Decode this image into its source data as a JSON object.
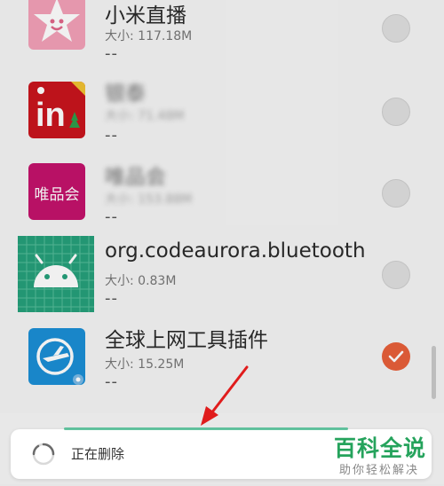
{
  "apps": [
    {
      "name": "小米直播",
      "size": "大小: 117.18M",
      "dash": "--",
      "checked": false
    },
    {
      "name": "银泰",
      "size": "大小: 71.48M",
      "dash": "--",
      "checked": false
    },
    {
      "name": "唯品会",
      "size": "大小: 153.88M",
      "dash": "--",
      "checked": false,
      "icon_text": "唯品会"
    },
    {
      "name": "org.codeaurora.bluetooth",
      "size": "大小: 0.83M",
      "dash": "--",
      "checked": false
    },
    {
      "name": "全球上网工具插件",
      "size": "大小: 15.25M",
      "dash": "--",
      "checked": true
    }
  ],
  "status": {
    "text": "正在删除"
  },
  "watermark": {
    "main": "百科全说",
    "sub": "助你轻松解决"
  },
  "colors": {
    "accent": "#e8603a",
    "brand_green": "#25a35c",
    "vip_pink": "#c4136c",
    "yintai_red": "#c9151d",
    "blue_tool": "#1b8fd6",
    "android_teal": "#26a07b"
  },
  "icons": [
    "star-icon",
    "yintai-in-icon",
    "vip-icon",
    "android-icon",
    "airplane-icon",
    "checkmark-icon",
    "spinner-icon",
    "arrow-icon"
  ]
}
